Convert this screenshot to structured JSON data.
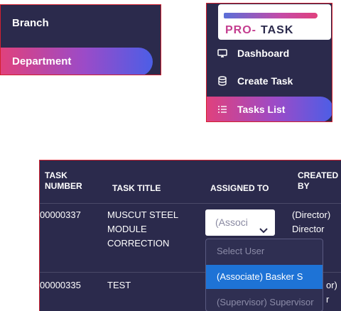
{
  "left_menu": {
    "items": [
      {
        "label": "Branch"
      },
      {
        "label": "Department",
        "active": true
      }
    ]
  },
  "sidebar": {
    "logo": {
      "part1": "PRO-",
      "part2": "TASK"
    },
    "items": [
      {
        "label": "Dashboard",
        "icon": "monitor-icon"
      },
      {
        "label": "Create Task",
        "icon": "database-icon"
      },
      {
        "label": "Tasks List",
        "icon": "list-icon",
        "active": true
      }
    ],
    "active_gradient": [
      "#e0417d",
      "#9b4bc8",
      "#4c5ee6"
    ]
  },
  "table": {
    "headers": {
      "task_number": "TASK NUMBER",
      "task_title": "TASK TITLE",
      "assigned_to": "ASSIGNED TO",
      "created_by": "CREATED BY"
    },
    "rows": [
      {
        "task_number": "00000337",
        "task_title": "MUSCUT STEEL MODULE CORRECTION",
        "assigned_to": "(Associ",
        "created_by_role": "(Director)",
        "created_by_name": "Director"
      },
      {
        "task_number": "00000335",
        "task_title": "TEST",
        "created_by_role": "or)",
        "created_by_name": "r"
      }
    ],
    "assign_dropdown": {
      "options": [
        "Select User",
        "(Associate) Basker S",
        "(Supervisor) Supervisor"
      ],
      "highlighted": "(Associate) Basker S"
    }
  },
  "colors": {
    "panel_bg": "#2b2a4c",
    "border": "#d2202f",
    "highlight": "#1e73d6"
  }
}
